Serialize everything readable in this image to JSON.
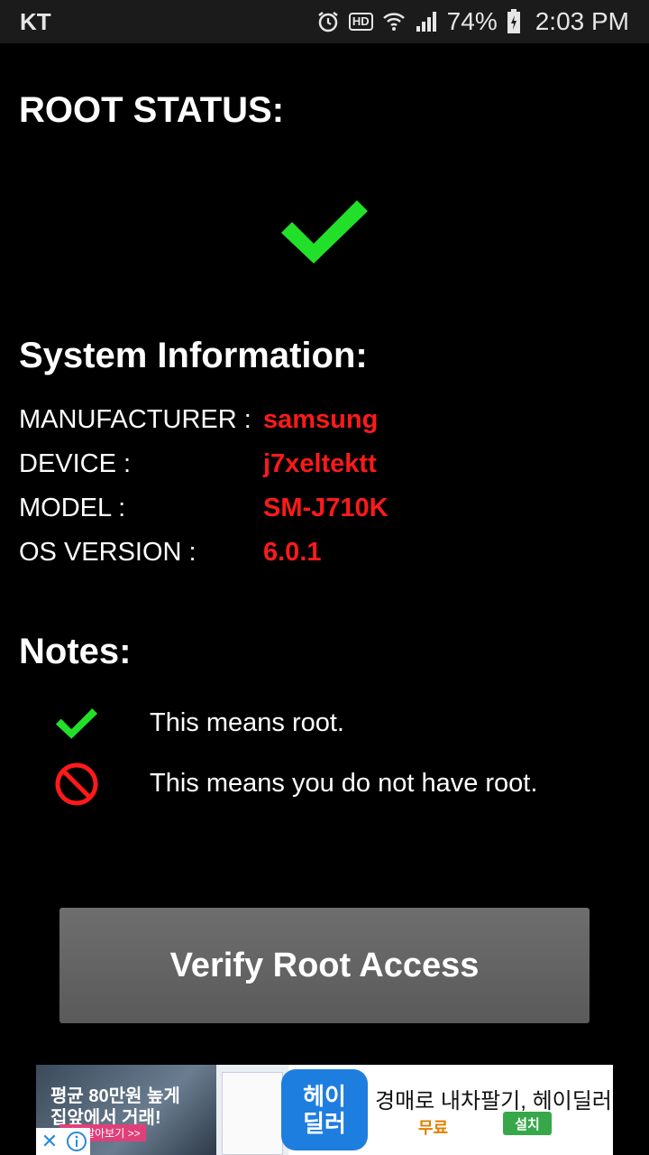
{
  "status_bar": {
    "carrier": "KT",
    "hd": "HD",
    "battery_percent": "74%",
    "time": "2:03 PM",
    "icons": [
      "alarm-icon",
      "hd-voice-icon",
      "wifi-icon",
      "signal-icon",
      "battery-charging-icon"
    ]
  },
  "root_status": {
    "heading": "ROOT STATUS:",
    "status_icon": "check-icon",
    "status_color": "#22e02a"
  },
  "system_info": {
    "heading": "System Information:",
    "rows": [
      {
        "label": "MANUFACTURER :",
        "value": "samsung"
      },
      {
        "label": "DEVICE :",
        "value": "j7xeltektt"
      },
      {
        "label": "MODEL :",
        "value": "SM-J710K"
      },
      {
        "label": "OS VERSION :",
        "value": "6.0.1"
      }
    ],
    "value_color": "#ff1a1a"
  },
  "notes": {
    "heading": "Notes:",
    "items": [
      {
        "icon": "check-icon",
        "text": "This means root."
      },
      {
        "icon": "no-root-icon",
        "text": "This means you do not have root."
      }
    ]
  },
  "verify_button": {
    "label": "Verify Root Access"
  },
  "ad": {
    "image_text_line1": "평균 80만원 높게",
    "image_text_line2": "집앞에서 거래!",
    "image_cta": "가격알아보기 >>",
    "logo_line1": "헤이",
    "logo_line2": "딜러",
    "title": "경매로 내차팔기, 헤이딜러",
    "price": "무료",
    "install": "설치",
    "close_glyph": "✕"
  }
}
